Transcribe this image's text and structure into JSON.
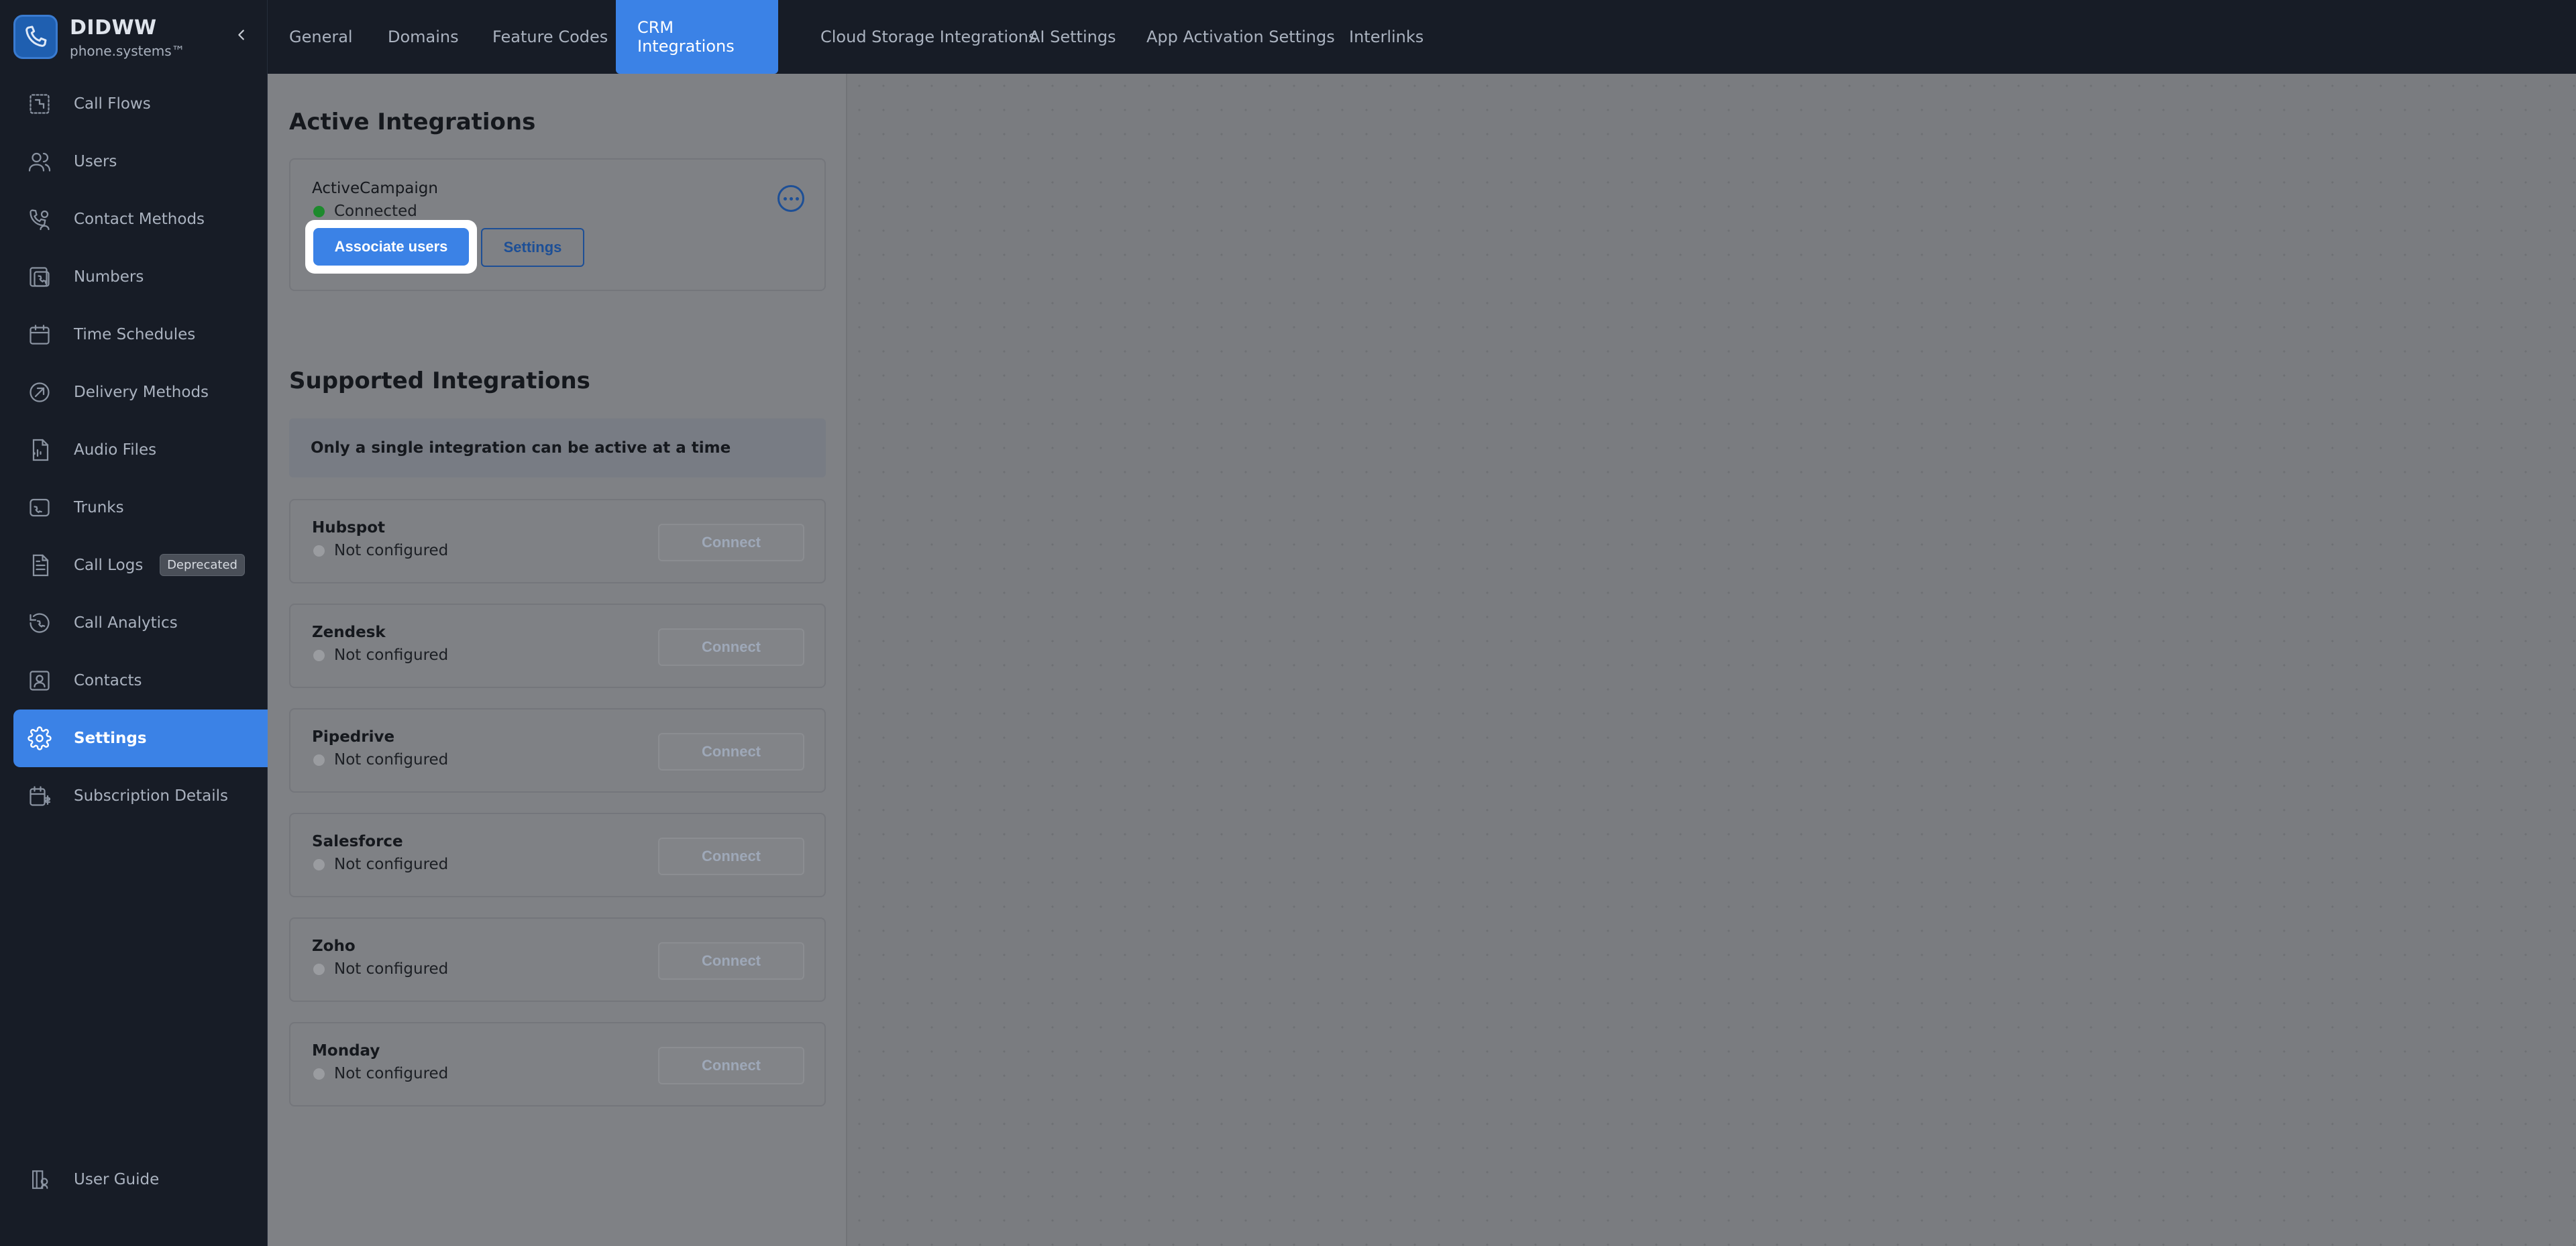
{
  "brand": {
    "name": "DIDWW",
    "subtitle": "phone.systems™"
  },
  "sidebar": {
    "items": [
      {
        "label": "Call Flows",
        "icon": "call-flows-icon"
      },
      {
        "label": "Users",
        "icon": "users-icon"
      },
      {
        "label": "Contact Methods",
        "icon": "contact-methods-icon"
      },
      {
        "label": "Numbers",
        "icon": "numbers-icon"
      },
      {
        "label": "Time Schedules",
        "icon": "calendar-icon"
      },
      {
        "label": "Delivery Methods",
        "icon": "delivery-icon"
      },
      {
        "label": "Audio Files",
        "icon": "audio-file-icon"
      },
      {
        "label": "Trunks",
        "icon": "trunk-icon"
      },
      {
        "label": "Call Logs",
        "icon": "document-icon",
        "badge": "Deprecated"
      },
      {
        "label": "Call Analytics",
        "icon": "analytics-icon"
      },
      {
        "label": "Contacts",
        "icon": "contacts-icon"
      },
      {
        "label": "Settings",
        "icon": "gear-icon",
        "active": true
      },
      {
        "label": "Subscription Details",
        "icon": "subscription-icon"
      }
    ],
    "footer": {
      "label": "User Guide",
      "icon": "user-guide-icon"
    }
  },
  "tabs": [
    {
      "label": "General"
    },
    {
      "label": "Domains"
    },
    {
      "label": "Feature Codes"
    },
    {
      "label": "CRM Integrations",
      "active": true
    },
    {
      "label": "Cloud Storage Integrations"
    },
    {
      "label": "AI Settings"
    },
    {
      "label": "App Activation Settings"
    },
    {
      "label": "Interlinks"
    }
  ],
  "active_section": {
    "title": "Active Integrations",
    "integration": {
      "name": "ActiveCampaign",
      "status": "Connected",
      "associate_label": "Associate users",
      "settings_label": "Settings"
    }
  },
  "supported_section": {
    "title": "Supported Integrations",
    "notice": "Only a single integration can be active at a time",
    "connect_label": "Connect",
    "integrations": [
      {
        "name": "Hubspot",
        "status": "Not configured"
      },
      {
        "name": "Zendesk",
        "status": "Not configured"
      },
      {
        "name": "Pipedrive",
        "status": "Not configured"
      },
      {
        "name": "Salesforce",
        "status": "Not configured"
      },
      {
        "name": "Zoho",
        "status": "Not configured"
      },
      {
        "name": "Monday",
        "status": "Not configured"
      }
    ]
  },
  "colors": {
    "accent": "#3b82e6",
    "sidebar_bg": "#171c26",
    "connected": "#1d8a2d"
  }
}
